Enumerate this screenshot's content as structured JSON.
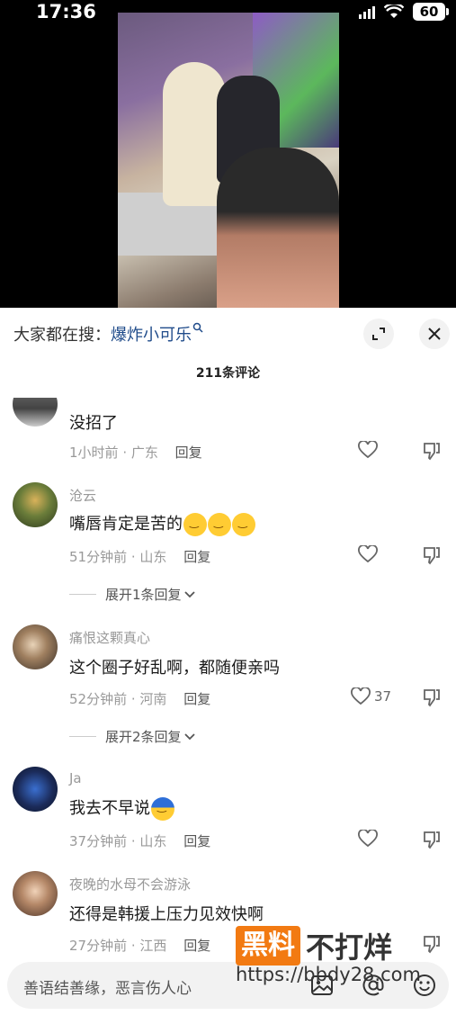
{
  "status_bar": {
    "time": "17:36",
    "battery": "60"
  },
  "search": {
    "prefix": "大家都在搜：",
    "term": "爆炸小可乐"
  },
  "comment_count": "211条评论",
  "comments": [
    {
      "username": "",
      "text": "没招了",
      "time": "1小时前",
      "location": "广东",
      "reply_label": "回复",
      "likes": ""
    },
    {
      "username": "沧云",
      "text": "嘴唇肯定是苦的",
      "time": "51分钟前",
      "location": "山东",
      "reply_label": "回复",
      "likes": "",
      "expand_label": "展开1条回复"
    },
    {
      "username": "痛恨这颗真心",
      "text": "这个圈子好乱啊，都随便亲吗",
      "time": "52分钟前",
      "location": "河南",
      "reply_label": "回复",
      "likes": "37",
      "expand_label": "展开2条回复"
    },
    {
      "username": "Ja",
      "text": "我去不早说",
      "time": "37分钟前",
      "location": "山东",
      "reply_label": "回复",
      "likes": ""
    },
    {
      "username": "夜晚的水母不会游泳",
      "text": "还得是韩援上压力见效快啊",
      "time": "27分钟前",
      "location": "江西",
      "reply_label": "回复",
      "likes": ""
    }
  ],
  "input": {
    "placeholder": "善语结善缘，恶言伤人心"
  },
  "watermark": {
    "logo": "黑料",
    "name": "不打烊",
    "url": "https://bbdy28.com"
  },
  "icons": [
    "search-icon",
    "expand-icon",
    "close-icon",
    "heart-icon",
    "dislike-icon",
    "chevron-down-icon",
    "image-icon",
    "at-icon",
    "emoji-icon"
  ]
}
